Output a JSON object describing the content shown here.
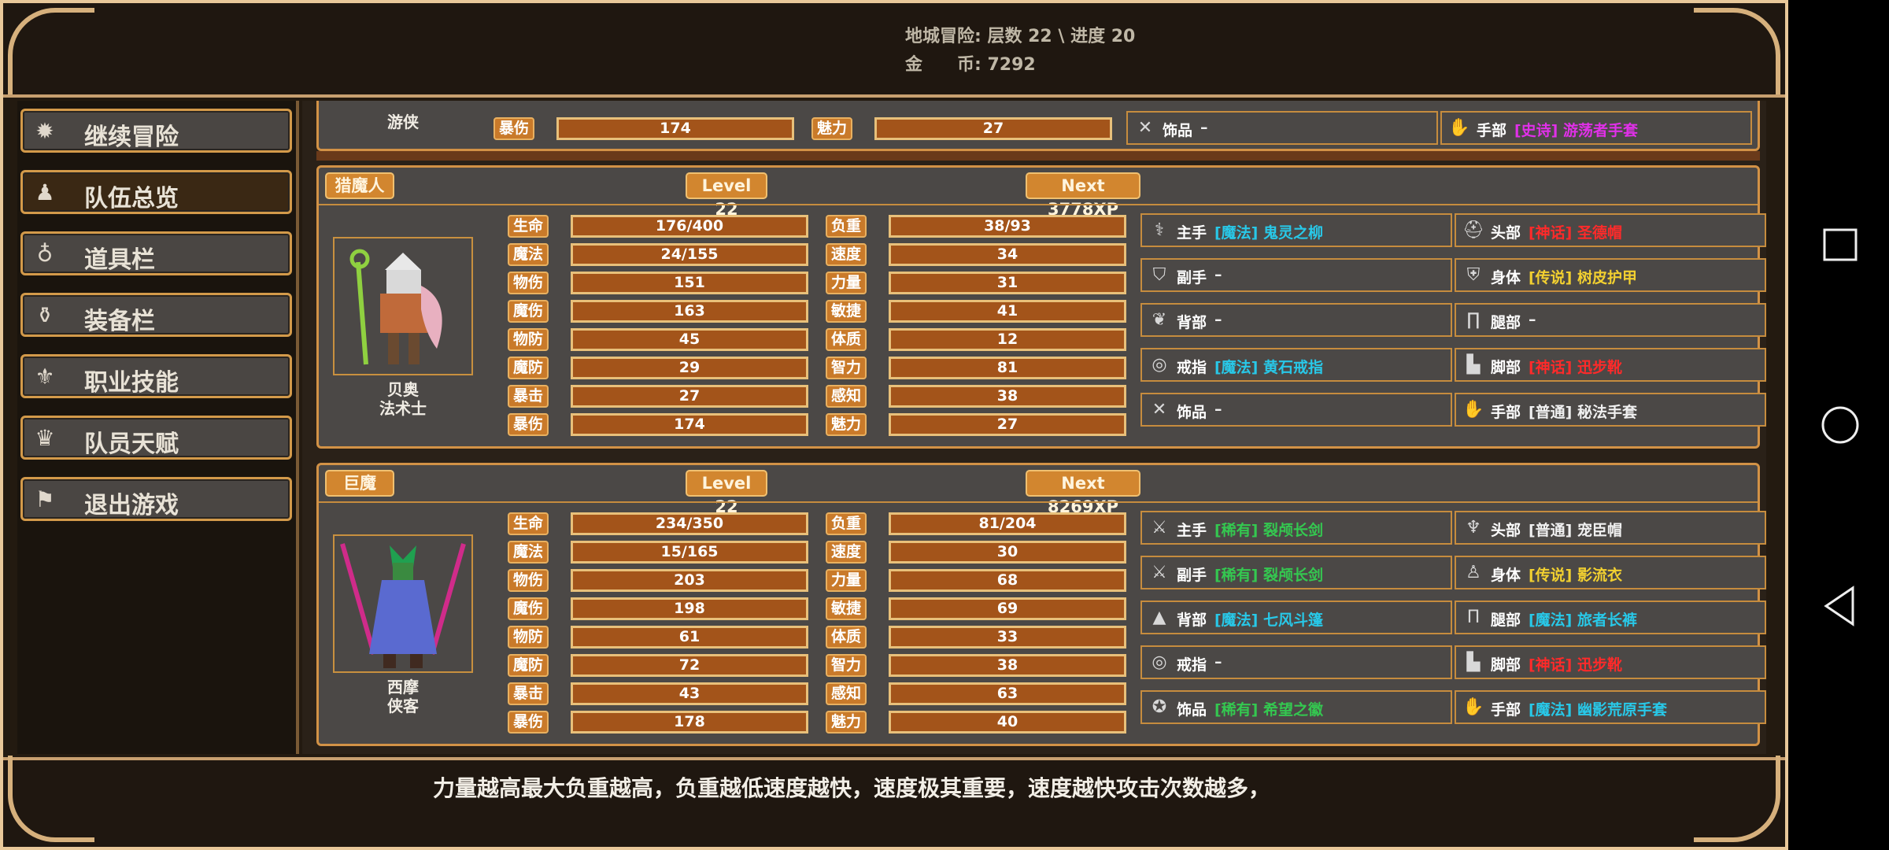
{
  "header": {
    "line1": "地城冒险: 层数 22 \\ 进度 20",
    "line2": "金　　币: 7292"
  },
  "menu": [
    {
      "label": "继续冒险",
      "icon": "dragon-icon"
    },
    {
      "label": "队伍总览",
      "icon": "party-icon"
    },
    {
      "label": "道具栏",
      "icon": "bag-icon"
    },
    {
      "label": "装备栏",
      "icon": "equipment-icon"
    },
    {
      "label": "职业技能",
      "icon": "skill-icon"
    },
    {
      "label": "队员天赋",
      "icon": "crown-icon"
    },
    {
      "label": "退出游戏",
      "icon": "flag-icon"
    }
  ],
  "partial": {
    "name": "游侠",
    "stats": {
      "l1": "暴伤",
      "v1": "174",
      "l2": "魅力",
      "v2": "27"
    },
    "equip": [
      {
        "slot": "饰品",
        "item": " –",
        "rarity": "",
        "icon": "crossed-swords-icon"
      },
      {
        "slot": "手部",
        "item": "[史诗] 游荡者手套",
        "rarity": "epic",
        "icon": "gauntlet-icon"
      }
    ]
  },
  "cards": [
    {
      "class_label": "猎魔人",
      "level": "Level 22",
      "next": "Next 3778XP",
      "name": "贝奥",
      "role": "法术士",
      "stats": [
        [
          "生命",
          "176/400",
          "负重",
          "38/93"
        ],
        [
          "魔法",
          "24/155",
          "速度",
          "34"
        ],
        [
          "物伤",
          "151",
          "力量",
          "31"
        ],
        [
          "魔伤",
          "163",
          "敏捷",
          "41"
        ],
        [
          "物防",
          "45",
          "体质",
          "12"
        ],
        [
          "魔防",
          "29",
          "智力",
          "81"
        ],
        [
          "暴击",
          "27",
          "感知",
          "38"
        ],
        [
          "暴伤",
          "174",
          "魅力",
          "27"
        ]
      ],
      "equip": [
        {
          "slot": "主手",
          "item": "[魔法] 鬼灵之柳",
          "rarity": "magic",
          "icon": "staff-icon"
        },
        {
          "slot": "头部",
          "item": "[神话] 圣德帽",
          "rarity": "myth",
          "icon": "hat-icon"
        },
        {
          "slot": "副手",
          "item": " –",
          "rarity": "",
          "icon": "shield-icon"
        },
        {
          "slot": "身体",
          "item": "[传说] 树皮护甲",
          "rarity": "legend",
          "icon": "armor-icon"
        },
        {
          "slot": "背部",
          "item": " –",
          "rarity": "",
          "icon": "wings-icon"
        },
        {
          "slot": "腿部",
          "item": " –",
          "rarity": "",
          "icon": "legs-icon"
        },
        {
          "slot": "戒指",
          "item": "[魔法] 黄石戒指",
          "rarity": "magic",
          "icon": "ring-icon"
        },
        {
          "slot": "脚部",
          "item": "[神话] 迅步靴",
          "rarity": "myth",
          "icon": "boots-icon"
        },
        {
          "slot": "饰品",
          "item": " –",
          "rarity": "",
          "icon": "crossed-swords-icon"
        },
        {
          "slot": "手部",
          "item": "[普通] 秘法手套",
          "rarity": "common",
          "icon": "gauntlet-icon"
        }
      ]
    },
    {
      "class_label": "巨魔",
      "level": "Level 22",
      "next": "Next 8269XP",
      "name": "西摩",
      "role": "侠客",
      "stats": [
        [
          "生命",
          "234/350",
          "负重",
          "81/204"
        ],
        [
          "魔法",
          "15/165",
          "速度",
          "30"
        ],
        [
          "物伤",
          "203",
          "力量",
          "68"
        ],
        [
          "魔伤",
          "198",
          "敏捷",
          "69"
        ],
        [
          "物防",
          "61",
          "体质",
          "33"
        ],
        [
          "魔防",
          "72",
          "智力",
          "38"
        ],
        [
          "暴击",
          "43",
          "感知",
          "63"
        ],
        [
          "暴伤",
          "178",
          "魅力",
          "40"
        ]
      ],
      "equip": [
        {
          "slot": "主手",
          "item": "[稀有] 裂颅长剑",
          "rarity": "rare",
          "icon": "sword-icon"
        },
        {
          "slot": "头部",
          "item": "[普通] 宠臣帽",
          "rarity": "common",
          "icon": "jester-hat-icon"
        },
        {
          "slot": "副手",
          "item": "[稀有] 裂颅长剑",
          "rarity": "rare",
          "icon": "sword-icon"
        },
        {
          "slot": "身体",
          "item": "[传说] 影流衣",
          "rarity": "legend",
          "icon": "robe-icon"
        },
        {
          "slot": "背部",
          "item": "[魔法] 七风斗篷",
          "rarity": "magic",
          "icon": "cloak-icon"
        },
        {
          "slot": "腿部",
          "item": "[魔法] 旅者长裤",
          "rarity": "magic",
          "icon": "pants-icon"
        },
        {
          "slot": "戒指",
          "item": " –",
          "rarity": "",
          "icon": "ring-icon"
        },
        {
          "slot": "脚部",
          "item": "[神话] 迅步靴",
          "rarity": "myth",
          "icon": "boots-icon"
        },
        {
          "slot": "饰品",
          "item": "[稀有] 希望之徽",
          "rarity": "rare",
          "icon": "medal-icon"
        },
        {
          "slot": "手部",
          "item": "[魔法] 幽影荒原手套",
          "rarity": "magic",
          "icon": "gauntlet-icon"
        }
      ]
    }
  ],
  "hint": "力量越高最大负重越高，负重越低速度越快，速度极其重要，速度越快攻击次数越多，",
  "nav": {
    "recent": "square-icon",
    "home": "circle-icon",
    "back": "triangle-icon"
  }
}
